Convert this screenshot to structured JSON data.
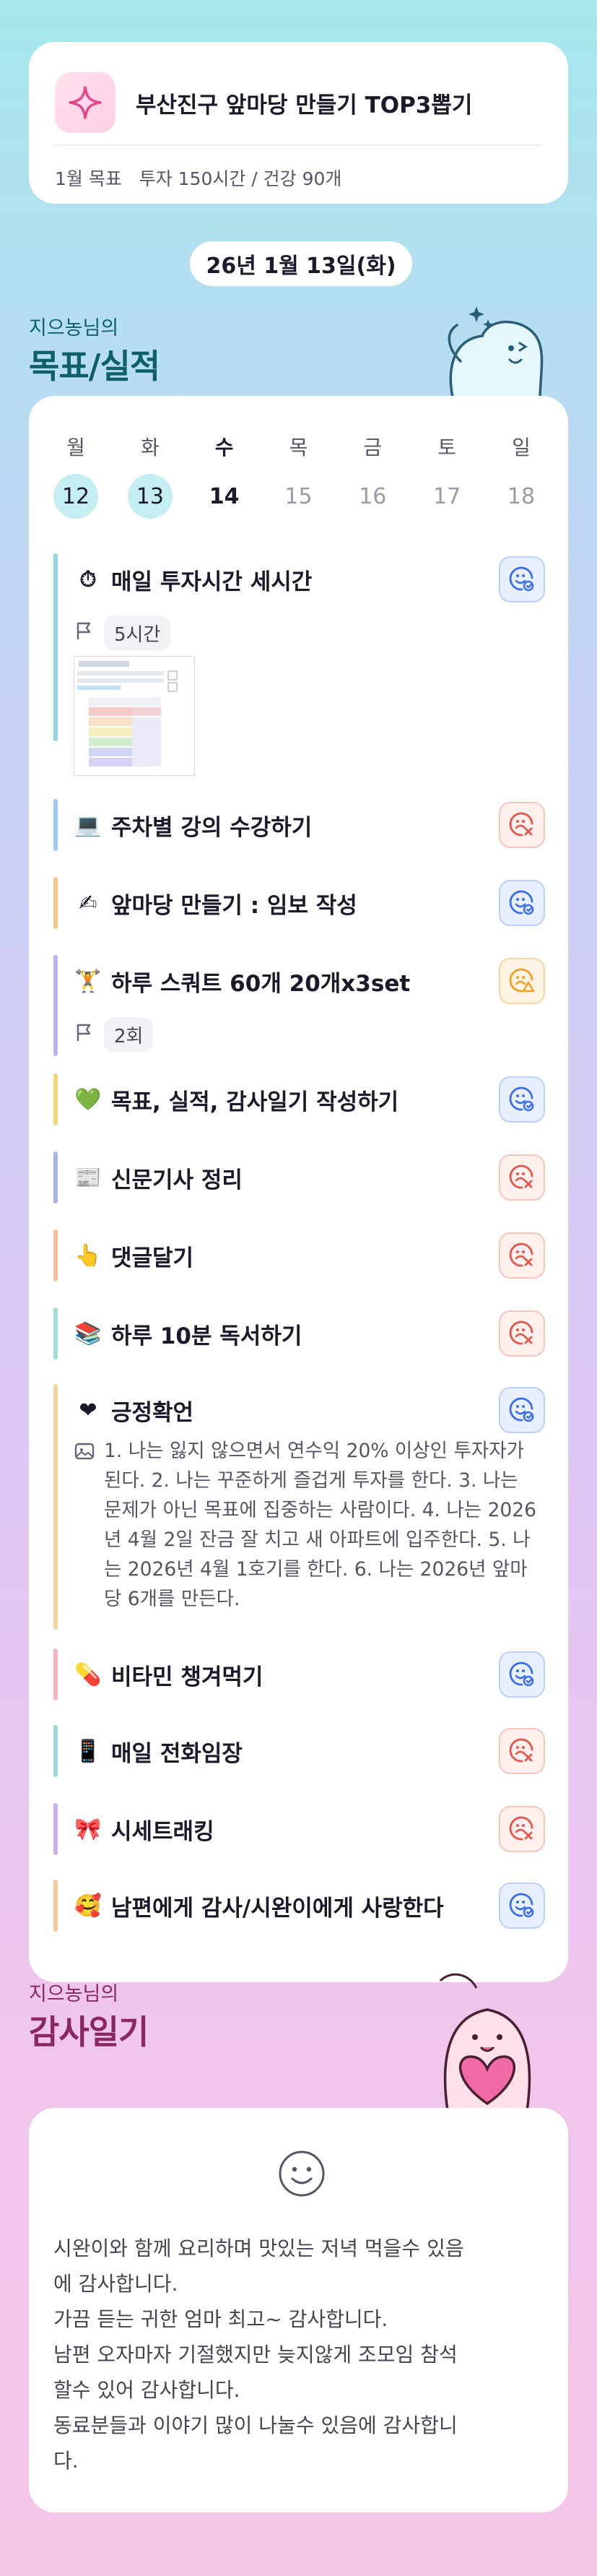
{
  "header": {
    "title": "부산진구 앞마당 만들기 TOP3뽑기",
    "subtitle": "1월 목표   투자 150시간 / 건강 90개",
    "icon": "sparkle-icon"
  },
  "date_label": "26년 1월 13일(화)",
  "goals_section": {
    "owner_line": "지으농님의",
    "title": "목표/실적"
  },
  "week": [
    {
      "name": "월",
      "date": "12",
      "state": "done"
    },
    {
      "name": "화",
      "date": "13",
      "state": "done"
    },
    {
      "name": "수",
      "date": "14",
      "state": "today"
    },
    {
      "name": "목",
      "date": "15",
      "state": "future"
    },
    {
      "name": "금",
      "date": "16",
      "state": "future"
    },
    {
      "name": "토",
      "date": "17",
      "state": "future"
    },
    {
      "name": "일",
      "date": "18",
      "state": "future"
    }
  ],
  "tasks": [
    {
      "emoji": "⏱",
      "title": "매일 투자시간 세시간",
      "status": "complete",
      "meta": "5시간",
      "has_image": true,
      "bar_color": "#8fd6de"
    },
    {
      "emoji": "💻",
      "title": "주차별 강의 수강하기",
      "status": "failed",
      "bar_color": "#9fc8f2"
    },
    {
      "emoji": "✍",
      "title": "앞마당 만들기 : 임보 작성",
      "status": "complete",
      "bar_color": "#f5c883"
    },
    {
      "emoji": "🏋",
      "title": "하루 스쿼트 60개 20개x3set",
      "status": "partial",
      "meta": "2회",
      "bar_color": "#b9b4ef"
    },
    {
      "emoji": "💚",
      "title": "목표, 실적, 감사일기 작성하기",
      "status": "complete",
      "bar_color": "#f3d67c"
    },
    {
      "emoji": "📰",
      "title": "신문기사 정리",
      "status": "failed",
      "bar_color": "#a9b4e6"
    },
    {
      "emoji": "👆",
      "title": "댓글달기",
      "status": "failed",
      "bar_color": "#f7bfa0"
    },
    {
      "emoji": "📚",
      "title": "하루 10분 독서하기",
      "status": "failed",
      "bar_color": "#9ee0d0"
    },
    {
      "emoji": "❤",
      "title": "긍정확언",
      "status": "complete",
      "memo": "1. 나는 잃지 않으면서 연수익 20% 이상인 투자자가 된다. 2. 나는 꾸준하게 즐겁게 투자를 한다. 3. 나는 문제가 아닌 목표에 집중하는 사람이다. 4. 나는 2026년 4월 2일 잔금 잘 치고 새 아파트에 입주한다. 5. 나는 2026년 4월 1호기를 한다. 6. 나는 2026년 앞마당 6개를 만든다.",
      "bar_color": "#f6d49a"
    },
    {
      "emoji": "💊",
      "title": "비타민 챙겨먹기",
      "status": "complete",
      "bar_color": "#f3b4bf"
    },
    {
      "emoji": "📱",
      "title": "매일 전화임장",
      "status": "failed",
      "bar_color": "#9ed8de"
    },
    {
      "emoji": "🎀",
      "title": "시세트래킹",
      "status": "failed",
      "bar_color": "#c5b3ef"
    },
    {
      "emoji": "🥰",
      "title": "남편에게 감사/시완이에게 사랑한다",
      "status": "complete",
      "bar_color": "#f7c897"
    }
  ],
  "thanks_section": {
    "owner_line": "지으농님의",
    "title": "감사일기",
    "mood_icon": "smile-face-icon",
    "lines": [
      "시완이와 함께 요리하며 맛있는 저녁 먹을수 있음",
      "에 감사합니다.",
      "가끔 듣는 귀한 엄마 최고~ 감사합니다.",
      "남편 오자마자 기절했지만 늦지않게 조모임 참석",
      "할수 있어 감사합니다.",
      "동료분들과 이야기 많이 나눌수 있음에 감사합니",
      "다."
    ]
  },
  "colors": {
    "complete": "#3a6fe8",
    "failed": "#e2574c",
    "partial": "#f0a020",
    "goals_heading": "#0e5f68",
    "thanks_heading": "#8a2763"
  }
}
